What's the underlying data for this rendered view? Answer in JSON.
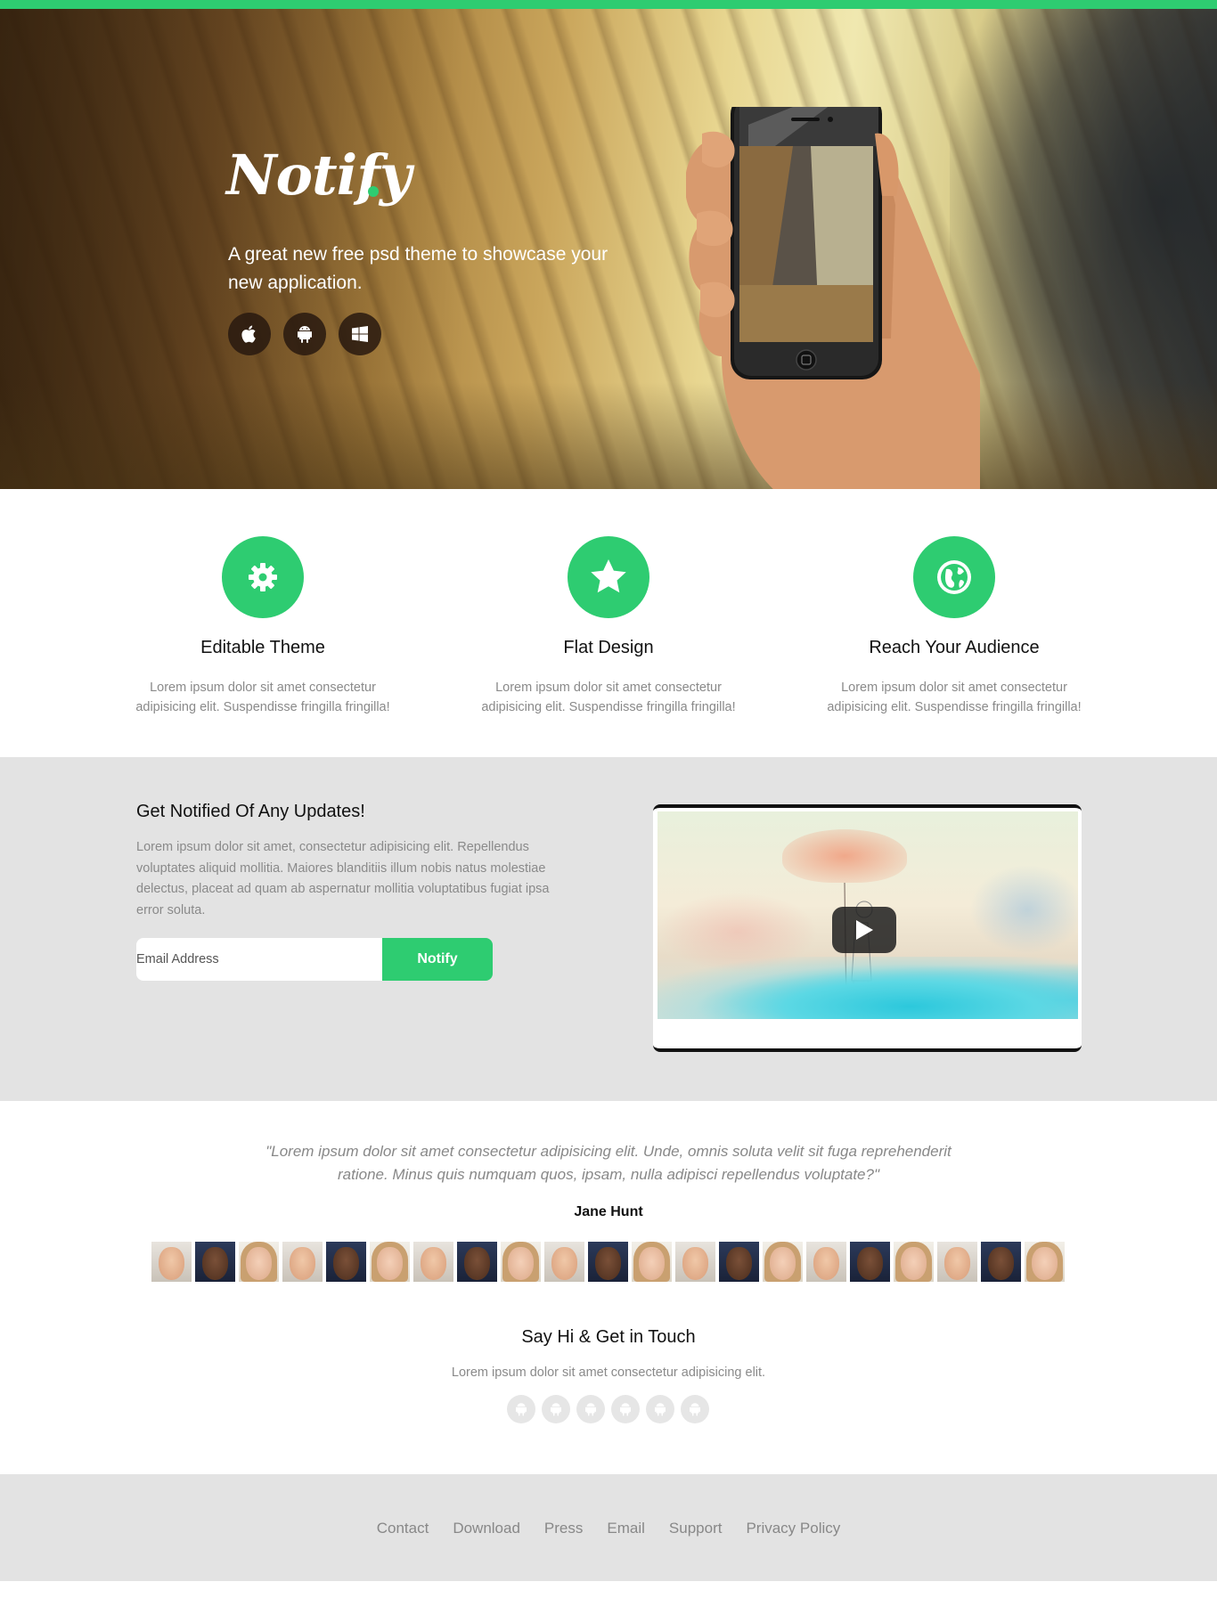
{
  "colors": {
    "accent": "#2ecc71",
    "section_gray": "#e3e3e3",
    "muted_text": "#8a8a8a"
  },
  "hero": {
    "logo": "Notify",
    "tagline": "A great new free psd theme to showcase your new application.",
    "platform_icons": [
      "apple-icon",
      "android-icon",
      "windows-icon"
    ]
  },
  "features": [
    {
      "icon": "gear-icon",
      "title": "Editable Theme",
      "text": "Lorem ipsum dolor sit amet consectetur adipisicing elit. Suspendisse fringilla fringilla!"
    },
    {
      "icon": "star-icon",
      "title": "Flat Design",
      "text": "Lorem ipsum dolor sit amet consectetur adipisicing elit. Suspendisse fringilla fringilla!"
    },
    {
      "icon": "globe-icon",
      "title": "Reach Your Audience",
      "text": "Lorem ipsum dolor sit amet consectetur adipisicing elit. Suspendisse fringilla fringilla!"
    }
  ],
  "notify": {
    "title": "Get Notified Of Any Updates!",
    "text": "Lorem ipsum dolor sit amet, consectetur adipisicing elit. Repellendus voluptates aliquid mollitia. Maiores blanditiis illum nobis natus molestiae delectus, placeat ad quam ab aspernatur mollitia voluptatibus fugiat ipsa error soluta.",
    "email_placeholder": "Email Address",
    "button_label": "Notify",
    "video_icon": "play-icon"
  },
  "testimonial": {
    "quote": "\"Lorem ipsum dolor sit amet consectetur adipisicing elit. Unde, omnis soluta velit sit fuga reprehenderit ratione. Minus quis numquam quos, ipsam, nulla adipisci repellendus voluptate?\"",
    "author": "Jane Hunt",
    "avatar_count": 21
  },
  "contact": {
    "title": "Say Hi & Get in Touch",
    "text": "Lorem ipsum dolor sit amet consectetur adipisicing elit.",
    "social_icons": [
      "android-icon",
      "android-icon",
      "android-icon",
      "android-icon",
      "android-icon",
      "android-icon"
    ]
  },
  "footer": {
    "links": [
      "Contact",
      "Download",
      "Press",
      "Email",
      "Support",
      "Privacy Policy"
    ]
  }
}
